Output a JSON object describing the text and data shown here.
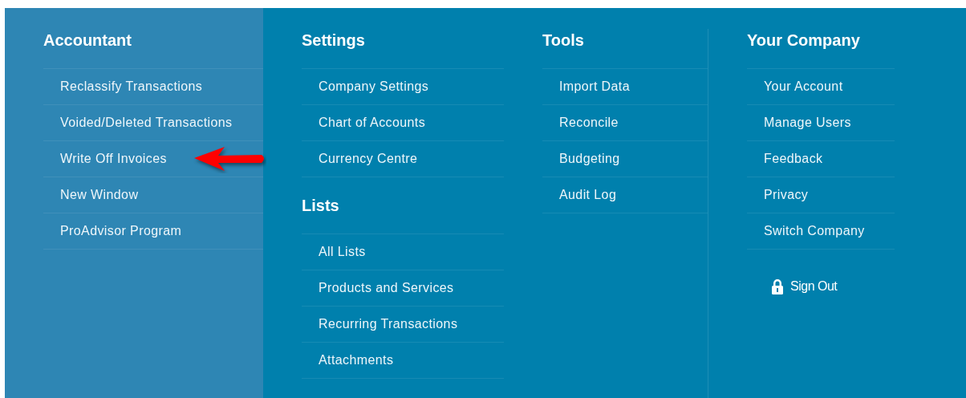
{
  "columns": [
    {
      "selected": true,
      "sections": [
        {
          "heading": "Accountant",
          "items": [
            {
              "label": "Reclassify Transactions",
              "marked": false
            },
            {
              "label": "Voided/Deleted Transactions",
              "marked": false
            },
            {
              "label": "Write Off Invoices",
              "marked": true
            },
            {
              "label": "New Window",
              "marked": false
            },
            {
              "label": "ProAdvisor Program",
              "marked": false
            }
          ]
        }
      ]
    },
    {
      "selected": false,
      "sections": [
        {
          "heading": "Settings",
          "items": [
            {
              "label": "Company Settings",
              "marked": false
            },
            {
              "label": "Chart of Accounts",
              "marked": false
            },
            {
              "label": "Currency Centre",
              "marked": false
            }
          ]
        },
        {
          "heading": "Lists",
          "items": [
            {
              "label": "All Lists",
              "marked": false
            },
            {
              "label": "Products and Services",
              "marked": false
            },
            {
              "label": "Recurring Transactions",
              "marked": false
            },
            {
              "label": "Attachments",
              "marked": false
            }
          ]
        }
      ]
    },
    {
      "selected": false,
      "sections": [
        {
          "heading": "Tools",
          "items": [
            {
              "label": "Import Data",
              "marked": false
            },
            {
              "label": "Reconcile",
              "marked": false
            },
            {
              "label": "Budgeting",
              "marked": false
            },
            {
              "label": "Audit Log",
              "marked": false
            }
          ]
        }
      ]
    },
    {
      "selected": false,
      "sections": [
        {
          "heading": "Your Company",
          "items": [
            {
              "label": "Your Account",
              "marked": false
            },
            {
              "label": "Manage Users",
              "marked": false
            },
            {
              "label": "Feedback",
              "marked": false
            },
            {
              "label": "Privacy",
              "marked": false
            },
            {
              "label": "Switch Company",
              "marked": false
            }
          ]
        }
      ],
      "sign_out": {
        "label": "Sign Out"
      }
    }
  ]
}
